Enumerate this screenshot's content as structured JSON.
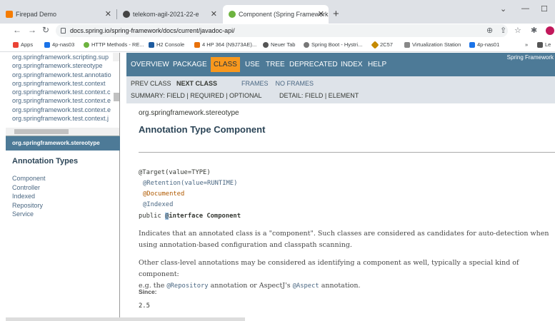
{
  "browser": {
    "tabs": [
      {
        "label": "Firepad Demo",
        "icon_color": "#f57c00"
      },
      {
        "label": "telekom-agil-2021-22-e",
        "icon_color": "#444"
      },
      {
        "label": "Component (Spring Framework !",
        "icon_color": "#6db33f"
      }
    ],
    "url": "docs.spring.io/spring-framework/docs/current/javadoc-api/",
    "bookmarks": [
      {
        "label": "Apps",
        "color": "#ea4335"
      },
      {
        "label": "4p-nas03",
        "color": "#1a73e8"
      },
      {
        "label": "HTTP Methods - RE...",
        "color": "#6db33f"
      },
      {
        "label": "H2 Console",
        "color": "#1e5b9f"
      },
      {
        "label": "4 HP 364 (N9J73AE)...",
        "color": "#e8710a"
      },
      {
        "label": "Neuer Tab",
        "color": "#555"
      },
      {
        "label": "Spring Boot - Hystri...",
        "color": "#777"
      },
      {
        "label": "2C57",
        "color": "#c58a00"
      },
      {
        "label": "Virtualization Station",
        "color": "#888"
      },
      {
        "label": "4p-nas01",
        "color": "#1a73e8"
      },
      {
        "label": "Le",
        "color": "#555"
      }
    ]
  },
  "packages": [
    "org.springframework.scripting.sup",
    "org.springframework.stereotype",
    "org.springframework.test.annotatio",
    "org.springframework.test.context",
    "org.springframework.test.context.c",
    "org.springframework.test.context.e",
    "org.springframework.test.context.e",
    "org.springframework.test.context.j"
  ],
  "class_frame": {
    "package": "org.springframework.stereotype",
    "heading": "Annotation Types",
    "items": [
      "Component",
      "Controller",
      "Indexed",
      "Repository",
      "Service"
    ]
  },
  "topnav": {
    "items": [
      "OVERVIEW",
      "PACKAGE",
      "CLASS",
      "USE",
      "TREE",
      "DEPRECATED",
      "INDEX",
      "HELP"
    ],
    "current": "CLASS",
    "brand": "Spring Framework"
  },
  "subnav": {
    "prev": "PREV CLASS",
    "next": "NEXT CLASS",
    "frames": "FRAMES",
    "noframes": "NO FRAMES",
    "summary": "SUMMARY: FIELD | REQUIRED | OPTIONAL",
    "detail": "DETAIL: FIELD | ELEMENT"
  },
  "content": {
    "package": "org.springframework.stereotype",
    "title": "Annotation Type Component",
    "code": {
      "target": "@Target(value=TYPE)",
      "retention": "@Retention(value=RUNTIME)",
      "documented": "@Documented",
      "indexed": "@Indexed",
      "decl_public": "public ",
      "decl_at": "@",
      "decl_rest": "interface Component"
    },
    "para1_line1": "Indicates that an annotated class is a \"component\". Such classes are considered as candidates for auto-detection when",
    "para1_line2": "using annotation-based configuration and classpath scanning.",
    "para2_line1": "Other class-level annotations may be considered as identifying a component as well, typically a special kind of component:",
    "para2_a": "e.g. the ",
    "para2_repo": "@Repository",
    "para2_b": " annotation or AspectJ's ",
    "para2_aspect": "@Aspect",
    "para2_c": " annotation.",
    "since_label": "Since:",
    "since_value": "2.5"
  }
}
